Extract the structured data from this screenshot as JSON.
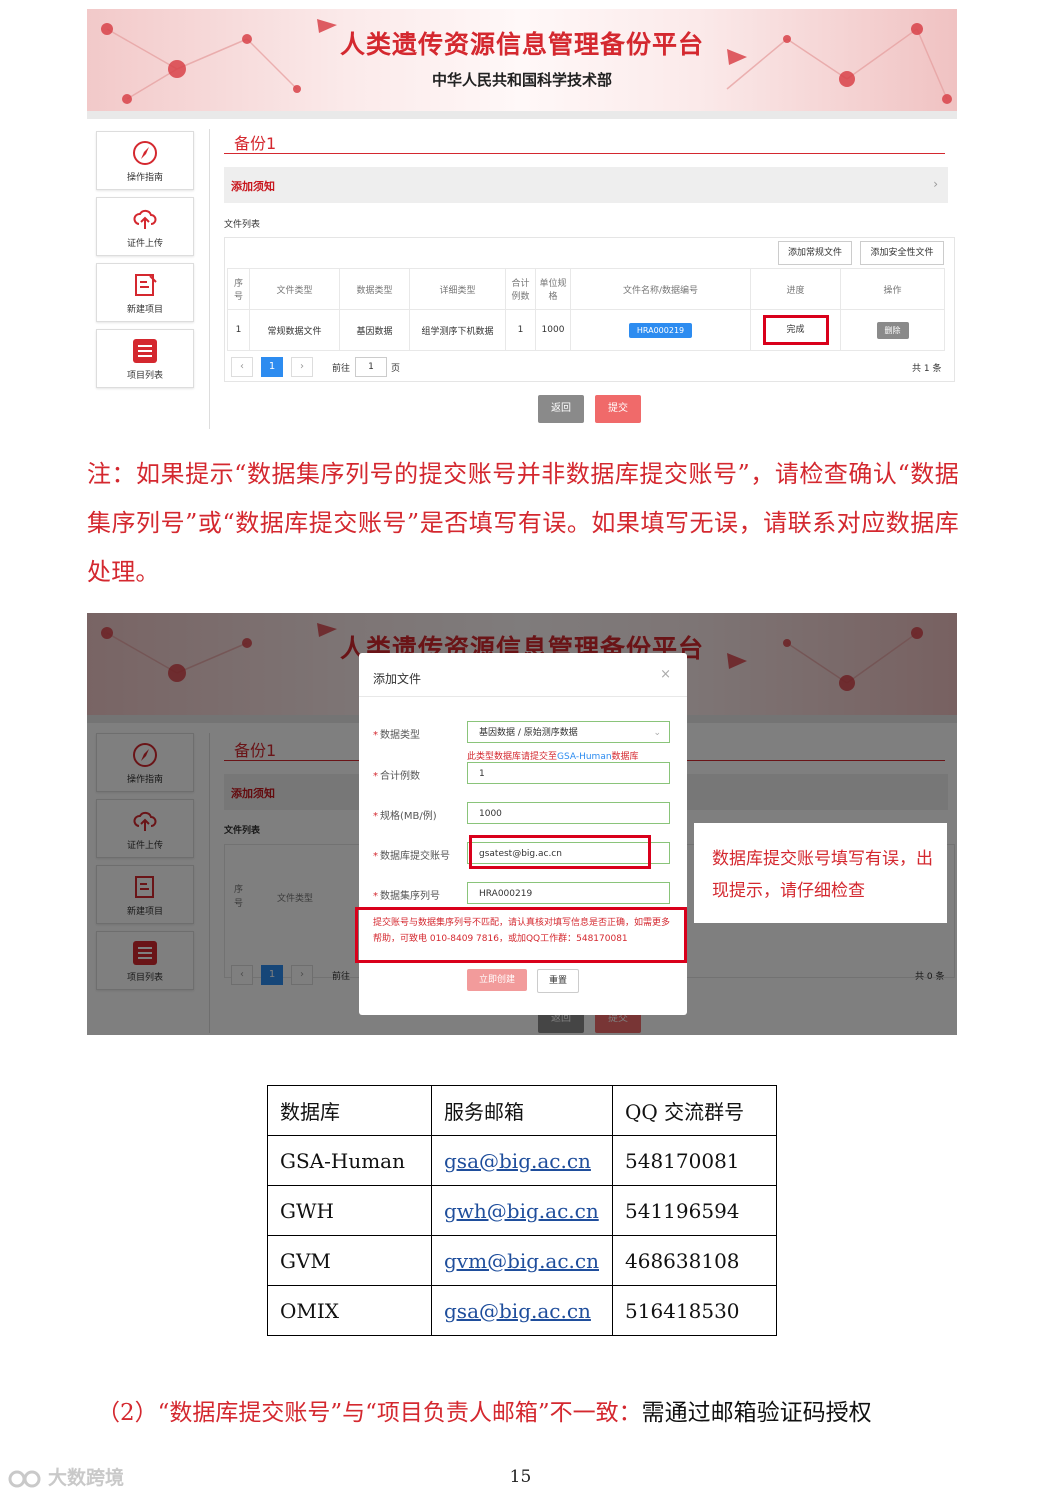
{
  "shot1": {
    "banner": {
      "title": "人类遗传资源信息管理备份平台",
      "subtitle": "中华人民共和国科学技术部"
    },
    "nav": [
      {
        "label": "操作指南",
        "icon": "compass-icon"
      },
      {
        "label": "证件上传",
        "icon": "cloud-upload-icon"
      },
      {
        "label": "新建项目",
        "icon": "edit-document-icon"
      },
      {
        "label": "项目列表",
        "icon": "list-icon"
      }
    ],
    "project_title": "备份1",
    "notice": "添加须知",
    "notice_arrow": "›",
    "file_list_label": "文件列表",
    "add_regular_btn": "添加常规文件",
    "add_security_btn": "添加安全性文件",
    "headers": [
      "序号",
      "文件类型",
      "数据类型",
      "详细类型",
      "合计例数",
      "单位规格",
      "文件名称/数据编号",
      "进度",
      "操作"
    ],
    "row": {
      "index": "1",
      "file_type": "常规数据文件",
      "data_type": "基因数据",
      "detail_type": "组学测序下机数据",
      "count": "1",
      "unit": "1000",
      "file_id": "HRA000219",
      "progress": "完成",
      "action": "删除"
    },
    "pager": {
      "prev": "‹",
      "page": "1",
      "next": "›",
      "goto": "前往",
      "goto_value": "1",
      "page_suffix": "页",
      "total": "共 1 条"
    },
    "back_btn": "返回",
    "submit_btn": "提交"
  },
  "note": "注：如果提示“数据集序列号的提交账号并非数据库提交账号”，请检查确认“数据集序列号”或“数据库提交账号”是否填写有误。如果填写无误，请联系对应数据库处理。",
  "shot2": {
    "banner_title": "人类遗传资源信息管理备份平台",
    "project_title": "备份1",
    "notice": "添加须知",
    "file_list_label": "文件列表",
    "headers": [
      "序号",
      "文件类型"
    ],
    "pager": {
      "page": "1",
      "goto": "前往",
      "total": "共 0 条"
    },
    "modal": {
      "title": "添加文件",
      "close": "×",
      "fields": [
        {
          "label": "数据类型",
          "value": "基因数据 / 原始测序数据"
        },
        {
          "label": "合计例数",
          "value": "1"
        },
        {
          "label": "规格(MB/例)",
          "value": "1000"
        },
        {
          "label": "数据库提交账号",
          "value": "gsatest@big.ac.cn"
        },
        {
          "label": "数据集序列号",
          "value": "HRA000219"
        }
      ],
      "hint_prefix": "此类型数据库请提交至",
      "hint_link": "GSA-Human",
      "hint_suffix": "数据库",
      "error": "提交账号与数据集序列号不匹配，请认真核对填写信息是否正确，如需更多帮助，可致电 010-8409 7816，或加QQ工作群：548170081",
      "create_btn": "立即创建",
      "reset_btn": "重置"
    },
    "callout": "数据库提交账号填写有误，出现提示，请仔细检查"
  },
  "db_table": {
    "headers": [
      "数据库",
      "服务邮箱",
      "QQ 交流群号"
    ],
    "rows": [
      {
        "db": "GSA-Human",
        "email": "gsa@big.ac.cn",
        "qq": "548170081"
      },
      {
        "db": "GWH",
        "email": "gwh@big.ac.cn",
        "qq": "541196594"
      },
      {
        "db": "GVM",
        "email": "gvm@big.ac.cn",
        "qq": "468638108"
      },
      {
        "db": "OMIX",
        "email": "gsa@big.ac.cn",
        "qq": "516418530"
      }
    ]
  },
  "section2": {
    "red": "（2）“数据库提交账号”与“项目负责人邮箱”不一致：",
    "black": "需通过邮箱验证码授权"
  },
  "page_number": "15",
  "watermark": "大数跨境",
  "colors": {
    "brand_red": "#d4282f",
    "link_blue": "#2d8cf0",
    "highlight_red": "#d9001b"
  }
}
